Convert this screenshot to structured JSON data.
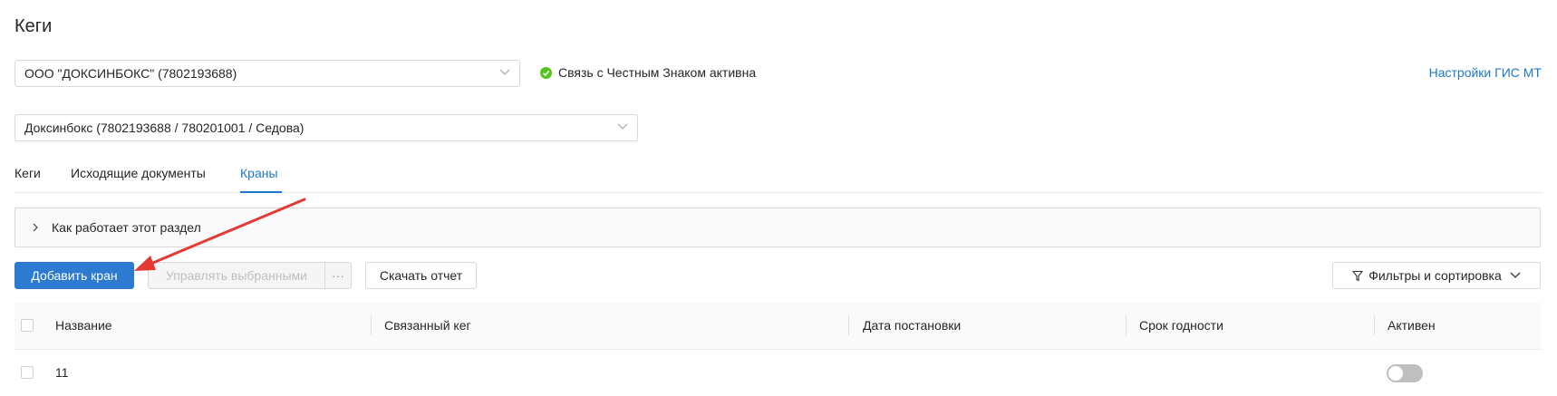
{
  "page": {
    "title": "Кеги"
  },
  "org_select": {
    "value": "ООО \"ДОКСИНБОКС\" (7802193688)"
  },
  "connection_status": {
    "text": "Связь с Честным Знаком активна",
    "color": "#52c41a"
  },
  "settings_link": {
    "label": "Настройки ГИС МТ"
  },
  "branch_select": {
    "value": "Доксинбокс (7802193688 / 780201001 / Седова)"
  },
  "tabs": [
    {
      "label": "Кеги",
      "active": false
    },
    {
      "label": "Исходящие документы",
      "active": false
    },
    {
      "label": "Краны",
      "active": true
    }
  ],
  "info_panel": {
    "label": "Как работает этот раздел"
  },
  "toolbar": {
    "add_label": "Добавить кран",
    "manage_label": "Управлять выбранными",
    "more_label": "···",
    "report_label": "Скачать отчет",
    "filters_label": "Фильтры и сортировка"
  },
  "table": {
    "columns": [
      "Название",
      "Связанный кег",
      "Дата постановки",
      "Срок годности",
      "Активен"
    ],
    "rows": [
      {
        "name": "11",
        "keg": "",
        "date": "",
        "expiry": "",
        "active": false
      }
    ]
  },
  "colors": {
    "accent": "#2c7bd0",
    "link": "#1e78c8",
    "annotation_arrow": "#e53935"
  }
}
